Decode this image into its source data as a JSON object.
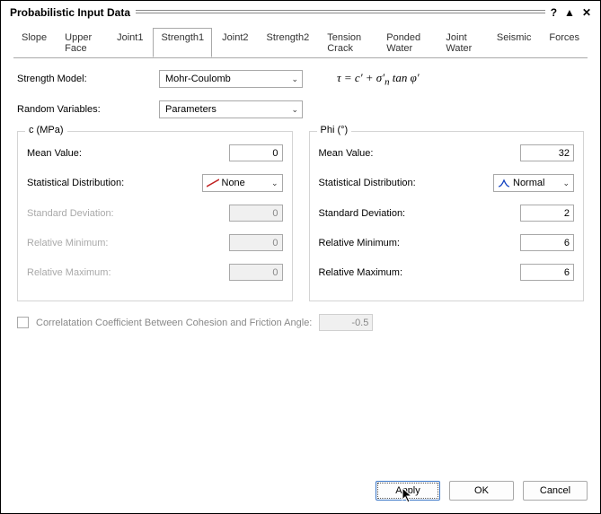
{
  "window": {
    "title": "Probabilistic Input Data"
  },
  "tabs": [
    "Slope",
    "Upper Face",
    "Joint1",
    "Strength1",
    "Joint2",
    "Strength2",
    "Tension Crack",
    "Ponded Water",
    "Joint Water",
    "Seismic",
    "Forces"
  ],
  "active_tab_index": 3,
  "fields": {
    "strength_model_label": "Strength Model:",
    "strength_model_value": "Mohr-Coulomb",
    "random_vars_label": "Random Variables:",
    "random_vars_value": "Parameters"
  },
  "group_c": {
    "title": "c (MPa)",
    "mean_label": "Mean Value:",
    "mean_value": "0",
    "dist_label": "Statistical Distribution:",
    "dist_value": "None",
    "std_label": "Standard Deviation:",
    "std_value": "0",
    "min_label": "Relative Minimum:",
    "min_value": "0",
    "max_label": "Relative Maximum:",
    "max_value": "0"
  },
  "group_phi": {
    "title": "Phi (°)",
    "mean_label": "Mean Value:",
    "mean_value": "32",
    "dist_label": "Statistical Distribution:",
    "dist_value": "Normal",
    "std_label": "Standard Deviation:",
    "std_value": "2",
    "min_label": "Relative Minimum:",
    "min_value": "6",
    "max_label": "Relative Maximum:",
    "max_value": "6"
  },
  "correlation": {
    "label": "Correlatation Coefficient Between Cohesion and Friction Angle:",
    "value": "-0.5"
  },
  "buttons": {
    "apply": "Apply",
    "ok": "OK",
    "cancel": "Cancel"
  }
}
